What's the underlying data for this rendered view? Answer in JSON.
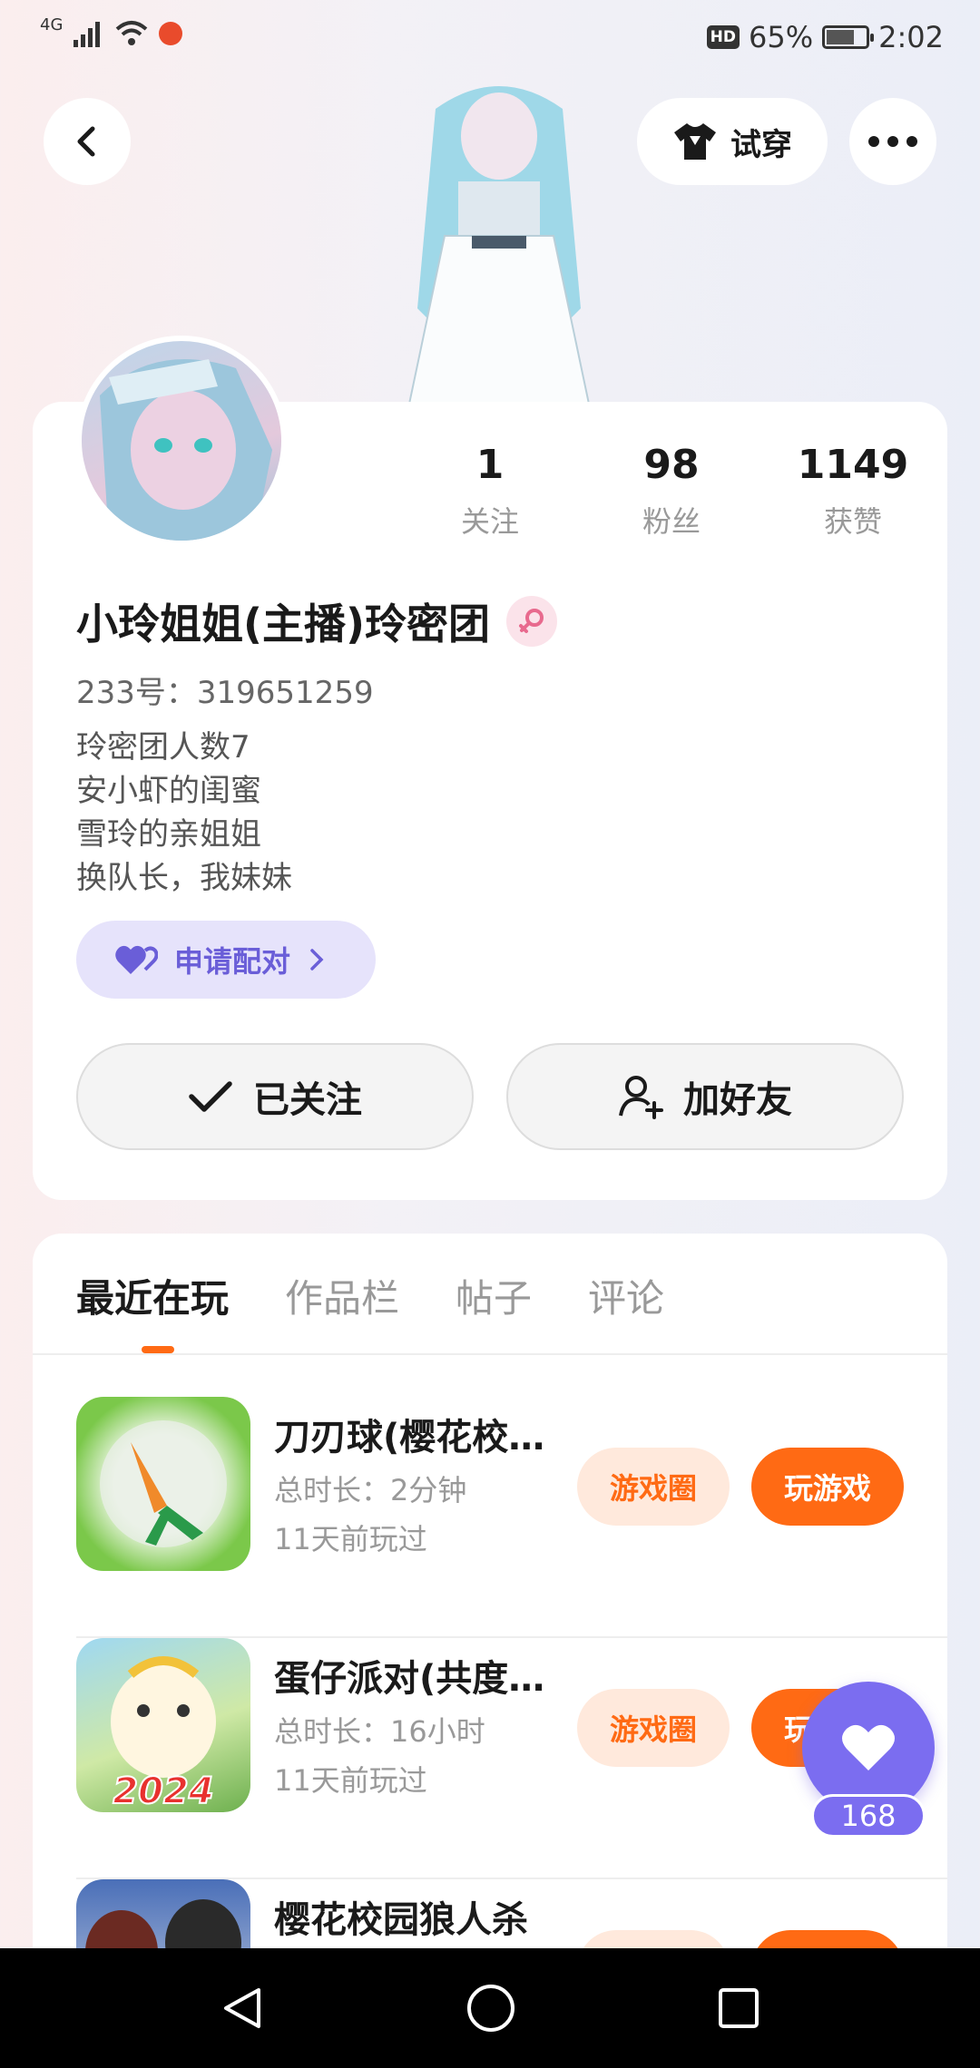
{
  "status_bar": {
    "network": "4G",
    "battery_percent": "65%",
    "battery_level": 0.65,
    "time": "2:02",
    "hd_badge": "HD"
  },
  "header": {
    "try_on_label": "试穿"
  },
  "profile": {
    "stats": [
      {
        "value": "1",
        "label": "关注"
      },
      {
        "value": "98",
        "label": "粉丝"
      },
      {
        "value": "1149",
        "label": "获赞"
      }
    ],
    "nickname": "小玲姐姐(主播)玲密团",
    "user_id": "233号：319651259",
    "bio": [
      "玲密团人数7",
      "安小虾的闺蜜",
      "雪玲的亲姐姐",
      "换队长，我妹妹"
    ],
    "pair_label": "申请配对",
    "follow_label": "已关注",
    "add_friend_label": "加好友"
  },
  "tabs": [
    {
      "label": "最近在玩",
      "active": true
    },
    {
      "label": "作品栏",
      "active": false
    },
    {
      "label": "帖子",
      "active": false
    },
    {
      "label": "评论",
      "active": false
    }
  ],
  "games": [
    {
      "title": "刀刃球(樱花校…",
      "duration": "总时长：2分钟",
      "last_played": "11天前玩过",
      "circle_label": "游戏圈",
      "play_label": "玩游戏"
    },
    {
      "title": "蛋仔派对(共度…",
      "duration": "总时长：16小时",
      "last_played": "11天前玩过",
      "circle_label": "游戏圈",
      "play_label": "玩游戏"
    },
    {
      "title": "樱花校园狼人杀",
      "duration": "",
      "last_played": "",
      "circle_label": "",
      "play_label": ""
    }
  ],
  "game_icon_texts": [
    "2024"
  ],
  "like": {
    "count": "168"
  },
  "colors": {
    "accent": "#ff6a14",
    "purple": "#7b6df0"
  }
}
